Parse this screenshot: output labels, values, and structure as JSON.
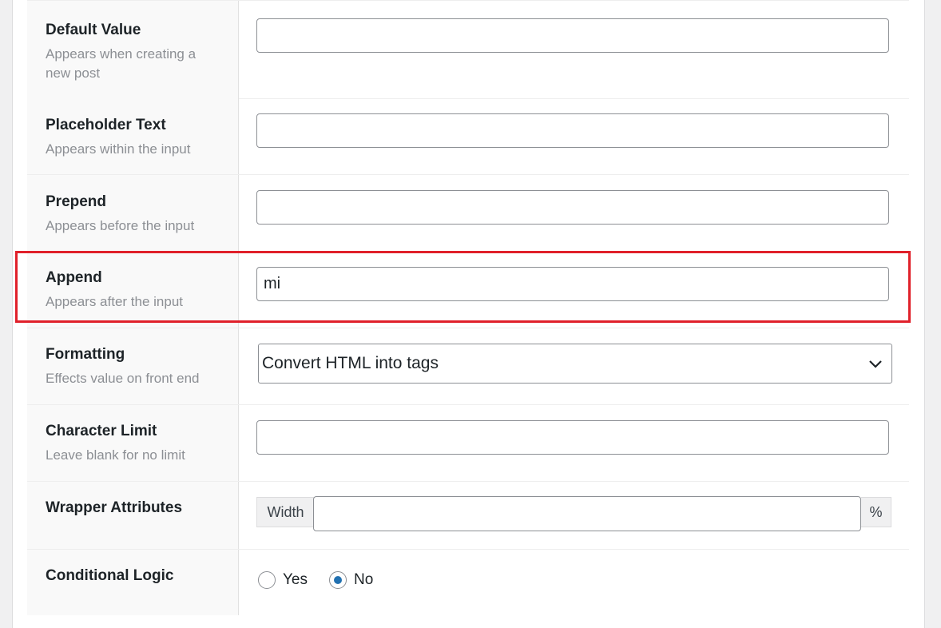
{
  "rows": [
    {
      "title": "Default Value",
      "desc": "Appears when creating a new post",
      "value": ""
    },
    {
      "title": "Placeholder Text",
      "desc": "Appears within the input",
      "value": ""
    },
    {
      "title": "Prepend",
      "desc": "Appears before the input",
      "value": ""
    },
    {
      "title": "Append",
      "desc": "Appears after the input",
      "value": "mi"
    },
    {
      "title": "Formatting",
      "desc": "Effects value on front end",
      "value": "Convert HTML into tags"
    },
    {
      "title": "Character Limit",
      "desc": "Leave blank for no limit",
      "value": ""
    },
    {
      "title": "Wrapper Attributes",
      "desc": "",
      "width_label": "Width",
      "width_value": "",
      "unit": "%"
    },
    {
      "title": "Conditional Logic",
      "desc": "",
      "options": [
        "Yes",
        "No"
      ],
      "selected": "No"
    }
  ],
  "colors": {
    "highlight": "#e0202a",
    "radio_checked": "#2271b1"
  }
}
